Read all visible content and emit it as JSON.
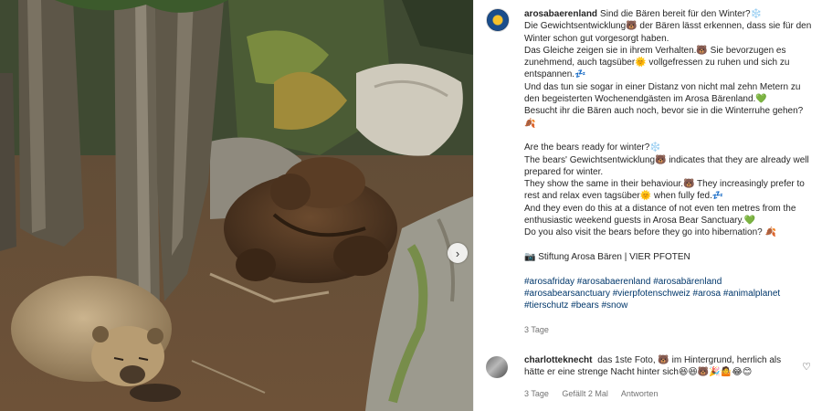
{
  "post": {
    "username": "arosabaerenland",
    "caption_de_1": "Sind die Bären bereit für den Winter?❄️\nDie Gewichtsentwicklung🐻 der Bären lässt erkennen, dass sie für den Winter schon gut vorgesorgt haben.\nDas Gleiche zeigen sie in ihrem Verhalten.🐻 Sie bevorzugen es zunehmend, auch tagsüber🌞 vollgefressen zu ruhen und sich zu entspannen.💤",
    "caption_de_2": "Und das tun sie sogar in einer Distanz von nicht mal zehn Metern zu den begeisterten Wochenendgästen im Arosa Bärenland.💚\nBesucht ihr die Bären auch noch, bevor sie in die Winterruhe gehen? 🍂",
    "caption_en": "Are the bears ready for winter?❄️\nThe bears' Gewichtsentwicklung🐻 indicates that they are already well prepared for winter.\nThey show the same in their behaviour.🐻 They increasingly prefer to rest and relax even tagsüber🌞 when fully fed.💤\nAnd they even do this at a distance of not even ten metres from the enthusiastic weekend guests in Arosa Bear Sanctuary.💚\nDo you also visit the bears before they go into hibernation? 🍂",
    "signature": "📷 Stiftung Arosa Bären | VIER PFOTEN",
    "hashtags": "#arosafriday #arosabaerenland #arosabärenland\n#arosabearsanctuary #vierpfotenschweiz #arosa #animalplanet\n#tierschutz #bears #snow",
    "time": "3 Tage"
  },
  "comment": {
    "username": "charlotteknecht",
    "text": "das 1ste Foto, 🐻 im Hintergrund, herrlich als hätte er eine strenge Nacht hinter sich😆😆🐻🎉🤷😂😊",
    "time": "3 Tage",
    "likes": "Gefällt 2 Mal",
    "reply": "Antworten"
  },
  "icons": {
    "next": "chevron-right-icon",
    "like": "heart-icon"
  }
}
